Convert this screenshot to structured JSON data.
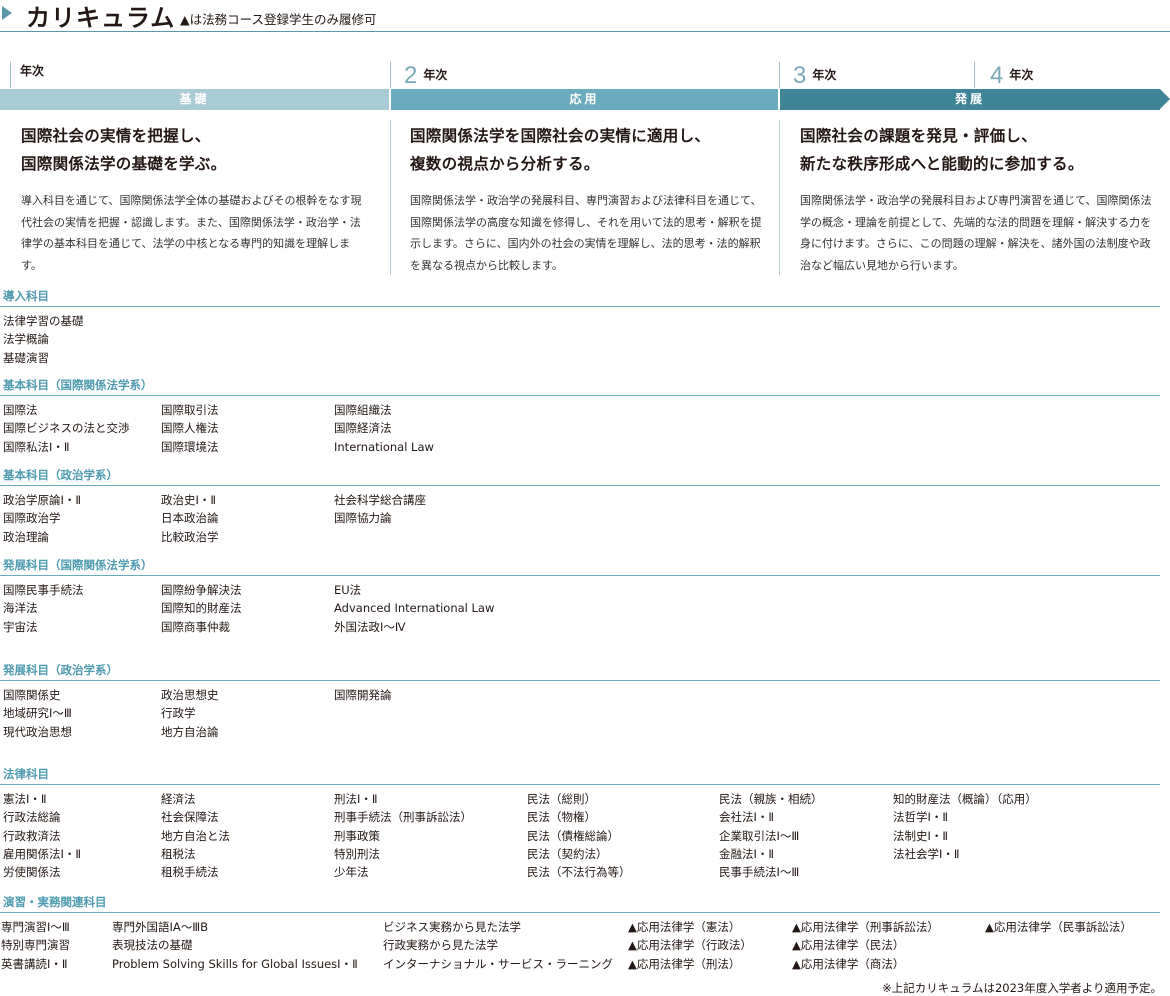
{
  "header": {
    "title": "カリキュラム",
    "note": "▲は法務コース登録学生のみ履修可"
  },
  "years": [
    {
      "num": "1",
      "label": "年次"
    },
    {
      "num": "2",
      "label": "年次"
    },
    {
      "num": "3",
      "label": "年次"
    },
    {
      "num": "4",
      "label": "年次"
    }
  ],
  "stages": [
    "基礎",
    "応用",
    "発展"
  ],
  "columns": [
    {
      "head": [
        "国際社会の実情を把握し、",
        "国際関係法学の基礎を学ぶ。"
      ],
      "body": "導入科目を通じて、国際関係法学全体の基礎およびその根幹をなす現代社会の実情を把握・認識します。また、国際関係法学・政治学・法律学の基本科目を通じて、法学の中核となる専門的知識を理解します。"
    },
    {
      "head": [
        "国際関係法学を国際社会の実情に適用し、",
        "複数の視点から分析する。"
      ],
      "body": "国際関係法学・政治学の発展科目、専門演習および法律科目を通じて、国際関係法学の高度な知識を修得し、それを用いて法的思考・解釈を提示します。さらに、国内外の社会の実情を理解し、法的思考・法的解釈を異なる視点から比較します。"
    },
    {
      "head": [
        "国際社会の課題を発見・評価し、",
        "新たな秩序形成へと能動的に参加する。"
      ],
      "body": "国際関係法学・政治学の発展科目および専門演習を通じて、国際関係法学の概念・理論を前提として、先端的な法的問題を理解・解決する力を身に付けます。さらに、この問題の理解・解決を、諸外国の法制度や政治など幅広い見地から行います。"
    }
  ],
  "sections": [
    {
      "title": "導入科目",
      "lists": [
        [
          "法律学習の基礎",
          "法学概論",
          "基礎演習"
        ]
      ]
    },
    {
      "title": "基本科目（国際関係法学系）",
      "lists": [
        [
          "国際法",
          "国際ビジネスの法と交渉",
          "国際私法Ⅰ・Ⅱ"
        ],
        [
          "国際取引法",
          "国際人権法",
          "国際環境法"
        ],
        [
          "国際組織法",
          "国際経済法",
          "International Law"
        ]
      ]
    },
    {
      "title": "基本科目（政治学系）",
      "lists": [
        [
          "政治学原論Ⅰ・Ⅱ",
          "国際政治学",
          "政治理論"
        ],
        [
          "政治史Ⅰ・Ⅱ",
          "日本政治論",
          "比較政治学"
        ],
        [
          "社会科学総合講座",
          "国際協力論"
        ]
      ]
    },
    {
      "title": "発展科目（国際関係法学系）",
      "lists": [
        [
          "国際民事手続法",
          "海洋法",
          "宇宙法"
        ],
        [
          "国際紛争解決法",
          "国際知的財産法",
          "国際商事仲裁"
        ],
        [
          "EU法",
          "Advanced International Law",
          "外国法政Ⅰ〜Ⅳ"
        ]
      ]
    },
    {
      "title": "発展科目（政治学系）",
      "lists": [
        [
          "国際関係史",
          "地域研究Ⅰ〜Ⅲ",
          "現代政治思想"
        ],
        [
          "政治思想史",
          "行政学",
          "地方自治論"
        ],
        [
          "国際開発論"
        ]
      ]
    },
    {
      "title": "法律科目",
      "lists": [
        [
          "憲法Ⅰ・Ⅱ",
          "行政法総論",
          "行政救済法",
          "雇用関係法Ⅰ・Ⅱ",
          "労使関係法"
        ],
        [
          "経済法",
          "社会保障法",
          "地方自治と法",
          "租税法",
          "租税手続法"
        ],
        [
          "刑法Ⅰ・Ⅱ",
          "刑事手続法（刑事訴訟法）",
          "刑事政策",
          "特別刑法",
          "少年法"
        ],
        [
          "民法（総則）",
          "民法（物権）",
          "民法（債権総論）",
          "民法（契約法）",
          "民法（不法行為等）"
        ],
        [
          "民法（親族・相続）",
          "会社法Ⅰ・Ⅱ",
          "企業取引法Ⅰ〜Ⅲ",
          "金融法Ⅰ・Ⅱ",
          "民事手続法Ⅰ〜Ⅲ"
        ],
        [
          "知的財産法（概論）（応用）",
          "法哲学Ⅰ・Ⅱ",
          "法制史Ⅰ・Ⅱ",
          "法社会学Ⅰ・Ⅱ"
        ]
      ]
    },
    {
      "title": "演習・実務関連科目",
      "lists": [
        [
          "専門演習Ⅰ〜Ⅲ",
          "特別専門演習",
          "英書講読Ⅰ・Ⅱ"
        ],
        [
          "専門外国語ⅠA〜ⅢB",
          "表現技法の基礎",
          "Problem Solving Skills for Global IssuesⅠ・Ⅱ"
        ],
        [
          "ビジネス実務から見た法学",
          "行政実務から見た法学",
          "インターナショナル・サービス・ラーニング"
        ],
        [
          "▲応用法律学（憲法）",
          "▲応用法律学（行政法）",
          "▲応用法律学（刑法）"
        ],
        [
          "▲応用法律学（刑事訴訟法）",
          "▲応用法律学（民法）",
          "▲応用法律学（商法）"
        ],
        [
          "▲応用法律学（民事訴訟法）"
        ]
      ]
    }
  ],
  "footer": "※上記カリキュラムは2023年度入学者より適用予定。"
}
